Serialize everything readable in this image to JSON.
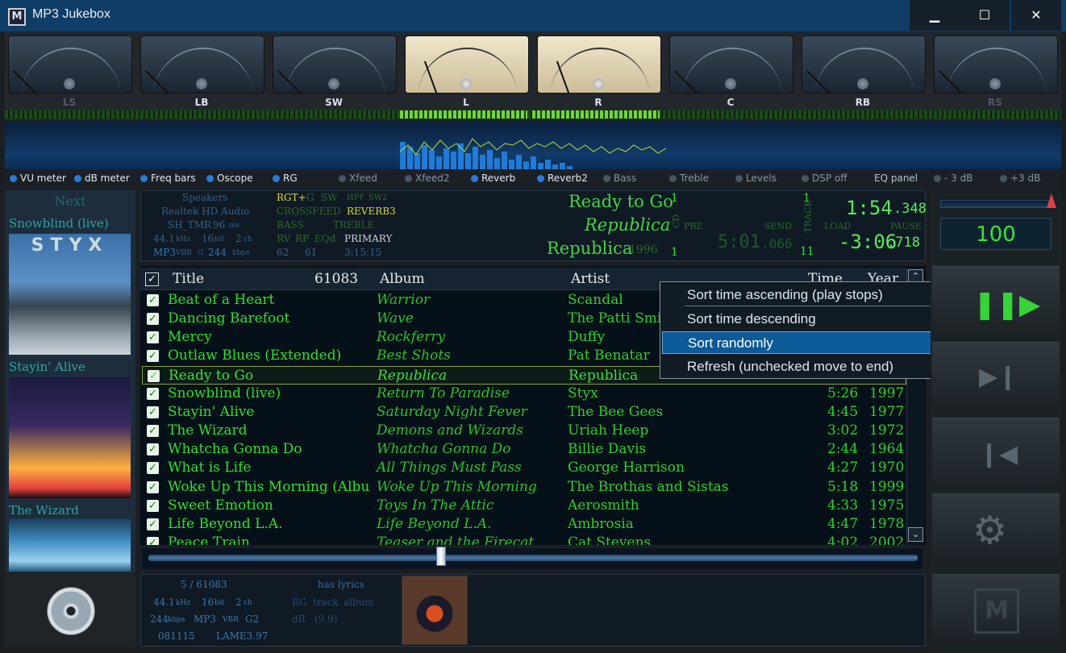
{
  "window": {
    "title": "MP3 Jukebox",
    "minimize": "▁",
    "maximize": "☐",
    "close": "✕"
  },
  "meters": [
    "LS",
    "LB",
    "SW",
    "L",
    "R",
    "C",
    "RB",
    "RS"
  ],
  "toggles": [
    {
      "label": "VU meter",
      "on": true
    },
    {
      "label": "dB meter",
      "on": true
    },
    {
      "label": "Freq bars",
      "on": true
    },
    {
      "label": "Oscope",
      "on": true
    },
    {
      "label": "RG",
      "on": true
    },
    {
      "label": "Xfeed",
      "on": false
    },
    {
      "label": "Xfeed2",
      "on": false
    },
    {
      "label": "Reverb",
      "on": true
    },
    {
      "label": "Reverb2",
      "on": true
    },
    {
      "label": "Bass",
      "on": false
    },
    {
      "label": "Treble",
      "on": false
    },
    {
      "label": "Levels",
      "on": false
    },
    {
      "label": "DSP off",
      "on": false
    },
    {
      "label": "EQ panel",
      "on": false
    },
    {
      "label": "- 3 dB",
      "on": false
    },
    {
      "label": "+3 dB",
      "on": false
    }
  ],
  "next": {
    "label": "Next",
    "covers": [
      {
        "title": "Snowblind (live)",
        "art_text": "STYX"
      },
      {
        "title": "Stayin' Alive",
        "art_text": ""
      },
      {
        "title": "The Wizard",
        "art_text": ""
      }
    ]
  },
  "info": {
    "device": "Speakers",
    "driver": "Realtek HD Audio",
    "timer": "SH_TMR",
    "timer_val": "96",
    "timer_unit": "ms",
    "rate": "44.1",
    "rate_unit": "kHz",
    "bits": "16",
    "bits_unit": "bit",
    "ch": "2",
    "ch_unit": "ch",
    "fmt": "MP3",
    "vbr": "VBR",
    "g": "G",
    "kbps": "244",
    "kbps_unit": "kbps",
    "rg": "RGT+",
    "g2": "G",
    "sw": "SW",
    "hpf": "HPF",
    "sw2": "SW2",
    "crossfeed": "CROSSFEED",
    "reverb": "REVERB3",
    "bass": "BASS",
    "treble": "TREBLE",
    "rv": "RV",
    "rp": "RP",
    "eq": "EQd",
    "primary": "PRIMARY",
    "n62": "62",
    "n61": "61",
    "dur": "3:15:15",
    "now_title": "Ready to Go",
    "now_album": "Republica",
    "now_artist": "Republica",
    "now_year": "1996",
    "n1a": "1",
    "n1b": "1",
    "cd": "CD",
    "pre": "PRE",
    "send": "SEND",
    "big_dim": "5:01",
    "big_dim_ms": ".066",
    "track": "TRACK",
    "t1": "1",
    "t11": "11",
    "load": "LOAD",
    "pause": "PAUSE",
    "elapsed": "1:54",
    "elapsed_ms": ".348",
    "remaining": "-3:06",
    "remaining_ms": ".718"
  },
  "playlist": {
    "headers": {
      "title": "Title",
      "count": "61083",
      "album": "Album",
      "artist": "Artist",
      "time": "Time",
      "year": "Year"
    },
    "rows": [
      {
        "title": "Beat of a Heart",
        "album": "Warrior",
        "artist": "Scandal",
        "time": "",
        "year": ""
      },
      {
        "title": "Dancing Barefoot",
        "album": "Wave",
        "artist": "The Patti Smi",
        "time": "",
        "year": ""
      },
      {
        "title": "Mercy",
        "album": "Rockferry",
        "artist": "Duffy",
        "time": "",
        "year": ""
      },
      {
        "title": "Outlaw Blues (Extended)",
        "album": "Best Shots",
        "artist": "Pat Benatar",
        "time": "",
        "year": ""
      },
      {
        "title": "Ready to Go",
        "album": "Republica",
        "artist": "Republica",
        "time": "",
        "year": "",
        "selected": true
      },
      {
        "title": "Snowblind (live)",
        "album": "Return To Paradise",
        "artist": "Styx",
        "time": "5:26",
        "year": "1997"
      },
      {
        "title": "Stayin' Alive",
        "album": "Saturday Night Fever",
        "artist": "The Bee Gees",
        "time": "4:45",
        "year": "1977"
      },
      {
        "title": "The Wizard",
        "album": "Demons and Wizards",
        "artist": "Uriah Heep",
        "time": "3:02",
        "year": "1972"
      },
      {
        "title": "Whatcha Gonna Do",
        "album": "Whatcha Gonna Do",
        "artist": "Billie Davis",
        "time": "2:44",
        "year": "1964"
      },
      {
        "title": "What is Life",
        "album": "All Things Must Pass",
        "artist": "George Harrison",
        "time": "4:27",
        "year": "1970"
      },
      {
        "title": "Woke Up This Morning (Albu",
        "album": "Woke Up This Morning",
        "artist": "The Brothas and Sistas",
        "time": "5:18",
        "year": "1999"
      },
      {
        "title": "Sweet Emotion",
        "album": "Toys In The Attic",
        "artist": "Aerosmith",
        "time": "4:33",
        "year": "1975"
      },
      {
        "title": "Life Beyond L.A.",
        "album": "Life Beyond L.A.",
        "artist": "Ambrosia",
        "time": "4:47",
        "year": "1978"
      },
      {
        "title": "Peace Train",
        "album": "Teaser and the Firecat",
        "artist": "Cat Stevens",
        "time": "4:02",
        "year": "2002"
      }
    ]
  },
  "context_menu": {
    "items": [
      {
        "label": "Sort time ascending (play stops)"
      },
      {
        "label": "Sort time descending"
      },
      {
        "label": "Sort randomly",
        "highlighted": true
      },
      {
        "label": "Refresh (unchecked move to end)"
      }
    ]
  },
  "bottom": {
    "position": "5 / 61083",
    "has_lyrics": "has lyrics",
    "rate": "44.1",
    "rate_unit": "kHz",
    "bits": "16",
    "bits_unit": "bit",
    "ch": "2",
    "ch_unit": "ch",
    "rg": "RG",
    "track": "track",
    "album": "album",
    "kbps": "244",
    "kbps_unit": "kbps",
    "fmt": "MP3",
    "vbr": "VBR",
    "g2": "G2",
    "db": "dB",
    "db_val": "(9.9)",
    "date": "081115",
    "encoder": "LAME3.97"
  },
  "volume": {
    "value": "100"
  },
  "colors": {
    "accent": "#0d5a99",
    "green": "#2ee02e",
    "titlebar": "#0f3d66"
  }
}
